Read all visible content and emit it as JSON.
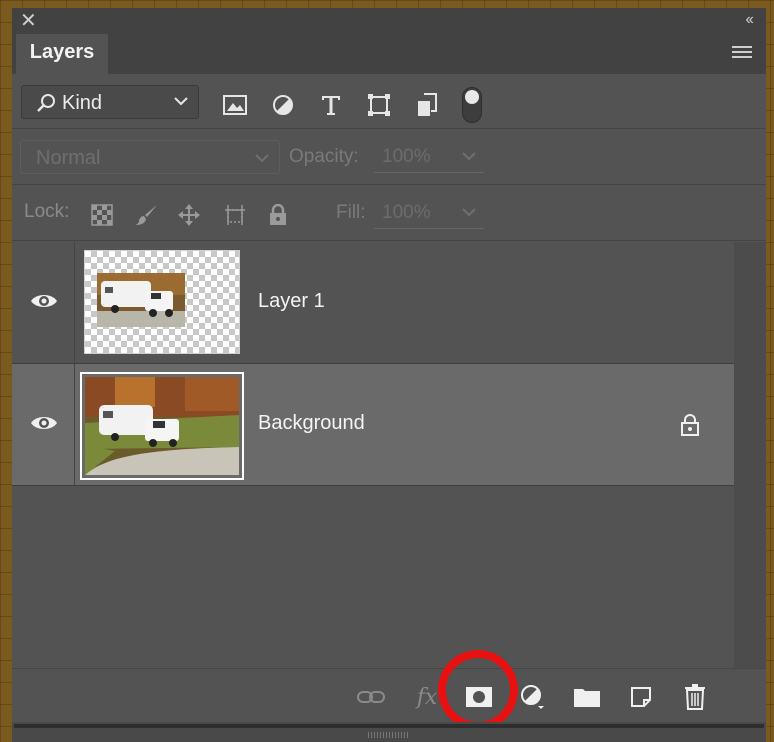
{
  "panel": {
    "tab_label": "Layers",
    "filter": {
      "kind_label": "Kind",
      "icons": [
        "image-icon",
        "adjustment-icon",
        "type-icon",
        "shape-icon",
        "smart-object-icon"
      ]
    },
    "blend_mode": {
      "value": "Normal"
    },
    "opacity": {
      "label": "Opacity:",
      "value": "100%"
    },
    "lock": {
      "label": "Lock:"
    },
    "fill": {
      "label": "Fill:",
      "value": "100%"
    },
    "layers": [
      {
        "name": "Layer 1",
        "visible": true,
        "selected": false,
        "locked": false
      },
      {
        "name": "Background",
        "visible": true,
        "selected": true,
        "locked": true
      }
    ],
    "bottom_buttons": [
      "link-layers",
      "fx",
      "add-mask",
      "adjustment-layer",
      "group",
      "new-layer",
      "delete"
    ],
    "fx_label": "fx",
    "colors": {
      "panel_bg": "#535353",
      "selected_row": "#6a6a6a",
      "highlight_circle": "#e81111"
    }
  }
}
